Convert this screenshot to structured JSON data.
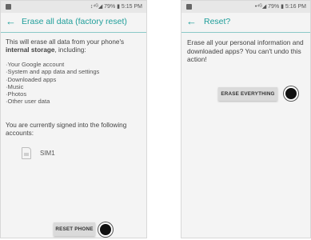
{
  "left": {
    "status": "↕⁴ᴳ◢ 79% ▮ 5:15 PM",
    "title": "Erase all data (factory reset)",
    "intro": "This will erase all data from your phone's",
    "intro_strong": "internal storage",
    "intro_end": ", including:",
    "items": [
      "Your Google account",
      "System and app data and settings",
      "Downloaded apps",
      "Music",
      "Photos",
      "Other user data"
    ],
    "signed_in": "You are currently signed into the following accounts:",
    "sim_label": "SIM1",
    "reset_button": "RESET PHONE"
  },
  "right": {
    "status": "•⁴ᴳ◢ 79% ▮ 5:16 PM",
    "title": "Reset?",
    "message": "Erase all your personal information and downloaded apps? You can't undo this action!",
    "erase_button": "ERASE EVERYTHING"
  },
  "colors": {
    "accent": "#1f9e9a",
    "background": "#f4f4f4",
    "button": "#dadada"
  }
}
